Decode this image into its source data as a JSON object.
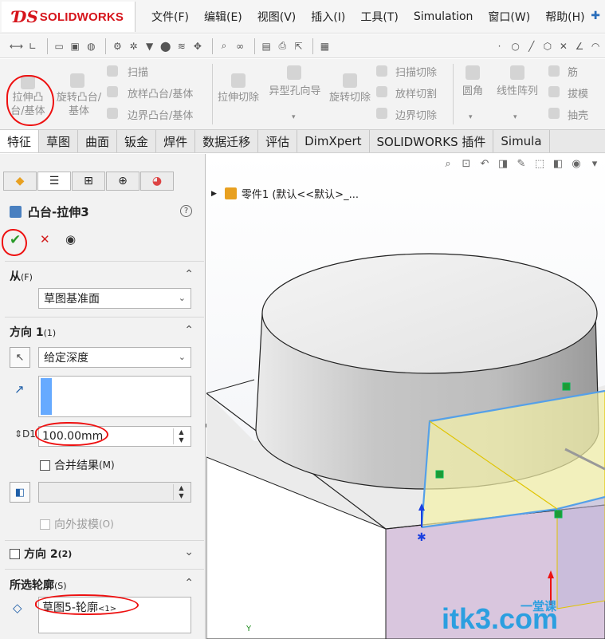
{
  "app": {
    "logo_ds": "ƊS",
    "logo_text": "SOLIDWORKS"
  },
  "menu": [
    "文件(F)",
    "编辑(E)",
    "视图(V)",
    "插入(I)",
    "工具(T)",
    "Simulation",
    "窗口(W)",
    "帮助(H)"
  ],
  "commands": {
    "extrude_boss": "拉伸凸台/基体",
    "revolve_boss": "旋转凸台/基体",
    "sweep": "扫描",
    "loft_boss": "放样凸台/基体",
    "boundary_boss": "边界凸台/基体",
    "extrude_cut": "拉伸切除",
    "hole_wizard": "异型孔向导",
    "revolve_cut": "旋转切除",
    "sweep_cut": "扫描切除",
    "loft_cut": "放样切割",
    "boundary_cut": "边界切除",
    "fillet": "圆角",
    "linear_pattern": "线性阵列",
    "rib": "筋",
    "draft": "拔模",
    "shell": "抽壳"
  },
  "tabs": [
    "特征",
    "草图",
    "曲面",
    "钣金",
    "焊件",
    "数据迁移",
    "评估",
    "DimXpert",
    "SOLIDWORKS 插件",
    "Simula"
  ],
  "active_tab": "特征",
  "property_manager": {
    "title": "凸台-拉伸3",
    "help_glyph": "?",
    "from": {
      "header": "从",
      "key": "(F)",
      "value": "草图基准面"
    },
    "direction1": {
      "header": "方向 1",
      "key": "(1)",
      "end_condition": "给定深度",
      "depth": "100.00mm",
      "merge_label": "合并结果",
      "merge_key": "(M)",
      "draft_outward_label": "向外拔模",
      "draft_outward_key": "(O)"
    },
    "direction2": {
      "header": "方向 2",
      "key": "(2)"
    },
    "selected_contours": {
      "header": "所选轮廓",
      "key": "(S)",
      "item_main": "草图5-轮廓",
      "item_sub": "<1>"
    }
  },
  "feature_tree": {
    "root": "零件1  (默认<<默认>_..."
  },
  "watermark": {
    "main": "itk3.com",
    "sub": "一堂课"
  },
  "colors": {
    "accent": "#2a6ebb",
    "brand_red": "#d6141b",
    "ok_green": "#2a9a2a",
    "preview_yellow": "#f5f2a8",
    "face_lilac": "#d9c6de"
  }
}
